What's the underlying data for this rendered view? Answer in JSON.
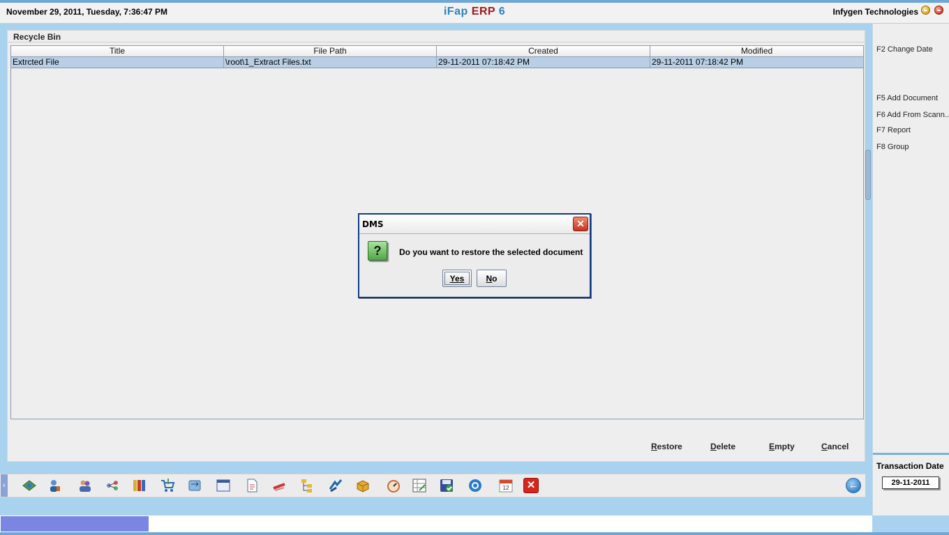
{
  "header": {
    "datetime": "November  29, 2011, Tuesday, 7:36:47 PM",
    "app_title_part1": "iFap",
    "app_title_part2": "ERP",
    "app_title_part3": "6",
    "company": "Infygen Technologies"
  },
  "panel": {
    "title": "Recycle Bin",
    "columns": [
      "Title",
      "File Path",
      "Created",
      "Modified"
    ],
    "rows": [
      {
        "title": "Extrcted File",
        "file_path": "\\root\\1_Extract Files.txt",
        "created": "29-11-2011 07:18:42 PM",
        "modified": "29-11-2011 07:18:42 PM"
      }
    ]
  },
  "actions": {
    "restore_m": "R",
    "restore_rest": "estore",
    "delete_m": "D",
    "delete_rest": "elete",
    "empty_m": "E",
    "empty_rest": "mpty",
    "cancel_m": "C",
    "cancel_rest": "ancel"
  },
  "right_panel": {
    "f2": "F2 Change Date",
    "f5": "F5 Add Document",
    "f6": "F6 Add From Scann...",
    "f7": "F7 Report",
    "f8": "F8 Group",
    "transaction_label": "Transaction Date",
    "transaction_date": "29-11-2011"
  },
  "toolbar": {
    "icons": [
      "map-icon",
      "user-phone-icon",
      "users-icon",
      "network-icon",
      "books-icon",
      "cart-icon",
      "transfer-icon",
      "window-icon",
      "document-icon",
      "tools-icon",
      "folder-tree-icon",
      "arrows-icon",
      "box-icon",
      "meter-icon",
      "calculator-icon",
      "save-icon",
      "gear-icon",
      "calendar-icon",
      "close-icon"
    ],
    "calendar_day": "12"
  },
  "status": {
    "progress_percent": 17
  },
  "dialog": {
    "title": "DMS",
    "message": "Do you want to restore the selected document",
    "yes_m": "Y",
    "yes_rest": "es",
    "no_m": "N",
    "no_rest": "o"
  },
  "colors": {
    "accent_blue": "#2a83c2",
    "accent_red": "#a01818",
    "selection": "#b8cfe5",
    "dialog_border": "#0e3a8a",
    "progress": "#7b86e3"
  }
}
